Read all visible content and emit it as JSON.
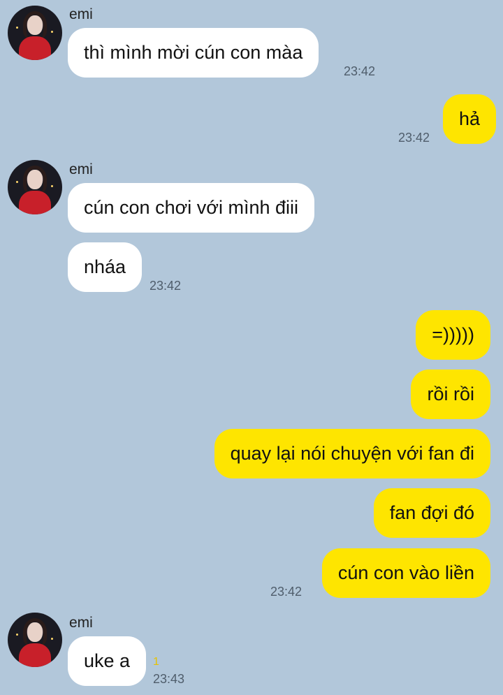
{
  "contact": {
    "name": "emi"
  },
  "messages": [
    {
      "direction": "in",
      "text": "thì mình mời cún con màa",
      "time": "23:42"
    },
    {
      "direction": "out",
      "text": "hả",
      "time": "23:42"
    },
    {
      "direction": "in",
      "text": "cún con chơi với mình điii"
    },
    {
      "direction": "in",
      "text": "nháa",
      "time": "23:42"
    },
    {
      "direction": "out",
      "text": "=)))))"
    },
    {
      "direction": "out",
      "text": "rồi rồi"
    },
    {
      "direction": "out",
      "text": "quay lại nói chuyện với fan đi"
    },
    {
      "direction": "out",
      "text": "fan đợi đó"
    },
    {
      "direction": "out",
      "text": "cún con vào liền",
      "time": "23:42"
    },
    {
      "direction": "in",
      "text": "uke a",
      "time": "23:43",
      "unread_count": "1"
    }
  ],
  "colors": {
    "background": "#b2c7da",
    "outgoing_bubble": "#fee500",
    "incoming_bubble": "#ffffff"
  }
}
